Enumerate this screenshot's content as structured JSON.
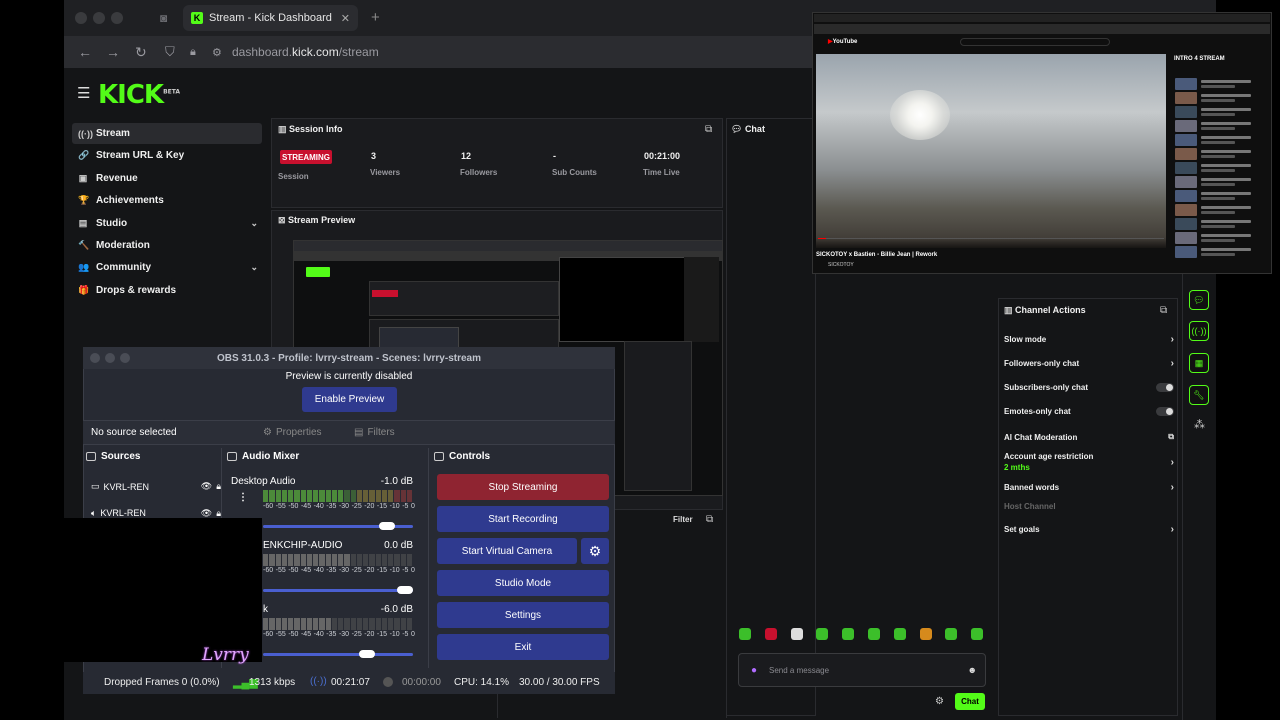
{
  "browser": {
    "tab_title": "Stream - Kick Dashboard",
    "url_prefix": "dashboard.",
    "url_domain": "kick.com",
    "url_path": "/stream"
  },
  "kick": {
    "logo": "KICK",
    "logo_beta": "BETA",
    "sidebar": [
      {
        "label": "Stream",
        "icon": "broadcast-icon",
        "glyph": "((·))"
      },
      {
        "label": "Stream URL & Key",
        "icon": "link-icon",
        "glyph": "🔗"
      },
      {
        "label": "Revenue",
        "icon": "revenue-icon",
        "glyph": "▣"
      },
      {
        "label": "Achievements",
        "icon": "trophy-icon",
        "glyph": "🏆"
      },
      {
        "label": "Studio",
        "icon": "studio-icon",
        "glyph": "▤"
      },
      {
        "label": "Moderation",
        "icon": "hammer-icon",
        "glyph": "🔨"
      },
      {
        "label": "Community",
        "icon": "community-icon",
        "glyph": "👥"
      },
      {
        "label": "Drops & rewards",
        "icon": "gift-icon",
        "glyph": "🎁"
      }
    ],
    "session": {
      "title": "Session Info",
      "status": "STREAMING",
      "status_label": "Session",
      "stats": [
        {
          "value": "3",
          "label": "Viewers"
        },
        {
          "value": "12",
          "label": "Followers"
        },
        {
          "value": "-",
          "label": "Sub Counts"
        },
        {
          "value": "00:21:00",
          "label": "Time Live"
        }
      ]
    },
    "preview_title": "Stream Preview",
    "chat_title": "Chat",
    "filter_label": "Filter",
    "chat_placeholder": "Send a message",
    "chat_button": "Chat",
    "channel_actions": {
      "title": "Channel Actions",
      "items": [
        {
          "label": "Slow mode",
          "control": "arrow"
        },
        {
          "label": "Followers-only chat",
          "control": "arrow"
        },
        {
          "label": "Subscribers-only chat",
          "control": "toggle"
        },
        {
          "label": "Emotes-only chat",
          "control": "toggle"
        },
        {
          "label": "AI Chat Moderation",
          "control": "external"
        },
        {
          "label": "Account age restriction",
          "control": "arrow",
          "sub": "2 mths"
        },
        {
          "label": "Banned words",
          "control": "arrow"
        },
        {
          "label": "Host Channel",
          "control": "none"
        },
        {
          "label": "Set goals",
          "control": "arrow"
        }
      ]
    }
  },
  "youtube": {
    "video_title": "SICKOTOY x Bastien - Billie Jean | Rework",
    "channel": "SICKOTOY",
    "playlist_title": "INTRO 4 STREAM"
  },
  "obs": {
    "title": "OBS 31.0.3 - Profile: lvrry-stream - Scenes: lvrry-stream",
    "preview_disabled": "Preview is currently disabled",
    "enable_preview": "Enable Preview",
    "no_source": "No source selected",
    "properties": "Properties",
    "filters": "Filters",
    "sources_title": "Sources",
    "sources": [
      "KVRL-REN",
      "KVRL-REN"
    ],
    "mixer_title": "Audio Mixer",
    "channels": [
      {
        "name": "Desktop Audio",
        "db": "-1.0 dB",
        "level": 0.85
      },
      {
        "name": "ENKCHIP-AUDIO",
        "db": "0.0 dB",
        "level": 0.97
      },
      {
        "name": "k",
        "db": "-6.0 dB",
        "level": 0.72
      }
    ],
    "ticks": [
      "-60",
      "-55",
      "-50",
      "-45",
      "-40",
      "-35",
      "-30",
      "-25",
      "-20",
      "-15",
      "-10",
      "-5",
      "0"
    ],
    "controls_title": "Controls",
    "stop_streaming": "Stop Streaming",
    "start_recording": "Start Recording",
    "start_virtual_camera": "Start Virtual Camera",
    "studio_mode": "Studio Mode",
    "settings": "Settings",
    "exit": "Exit",
    "status": {
      "dropped": "Dropped Frames 0 (0.0%)",
      "bitrate": "1313 kbps",
      "stream_time": "00:21:07",
      "rec_time": "00:00:00",
      "cpu": "CPU: 14.1%",
      "fps": "30.00 / 30.00 FPS"
    },
    "watermark": "Lvrry"
  }
}
